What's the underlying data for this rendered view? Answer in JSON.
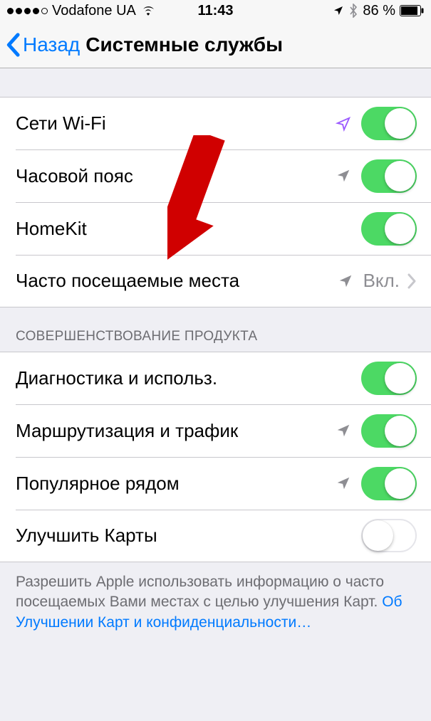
{
  "statusbar": {
    "carrier": "Vodafone UA",
    "time": "11:43",
    "battery_pct": "86 %"
  },
  "nav": {
    "back_label": "Назад",
    "title": "Системные службы"
  },
  "group1": {
    "items": [
      {
        "label": "Сети Wi-Fi",
        "loc": "purple",
        "toggle": true
      },
      {
        "label": "Часовой пояс",
        "loc": "grey",
        "toggle": true
      },
      {
        "label": "HomeKit",
        "loc": null,
        "toggle": true
      }
    ],
    "disclosure": {
      "label": "Часто посещаемые места",
      "value": "Вкл.",
      "loc": "grey"
    }
  },
  "group2": {
    "header": "СОВЕРШЕНСТВОВАНИЕ ПРОДУКТА",
    "items": [
      {
        "label": "Диагностика и использ.",
        "loc": null,
        "toggle": true
      },
      {
        "label": "Маршрутизация и трафик",
        "loc": "grey",
        "toggle": true
      },
      {
        "label": "Популярное рядом",
        "loc": "grey",
        "toggle": true
      },
      {
        "label": "Улучшить Карты",
        "loc": null,
        "toggle": false
      }
    ]
  },
  "footer": {
    "text": "Разрешить Apple использовать информацию о часто посещаемых Вами местах с целью улучшения Карт. ",
    "link": "Об Улучшении Карт и конфиденциальности…"
  },
  "colors": {
    "tint": "#007AFF",
    "switch_on": "#4CD964",
    "loc_purple": "#9B59FF",
    "loc_grey": "#8E8E93",
    "arrow_red": "#D00000"
  }
}
